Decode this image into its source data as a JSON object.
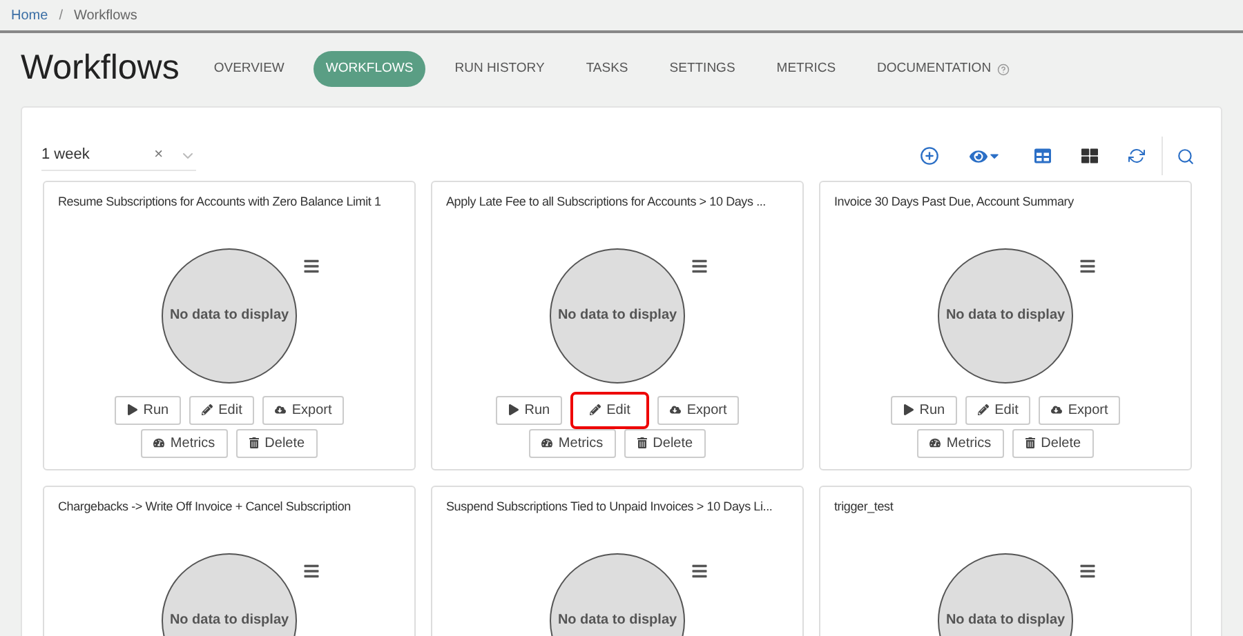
{
  "breadcrumb": [
    {
      "label": "Home",
      "link": true
    },
    {
      "label": "Workflows",
      "link": false
    }
  ],
  "breadcrumb_separator": "/",
  "page_title": "Workflows",
  "tabs": [
    {
      "label": "OVERVIEW",
      "selected": false
    },
    {
      "label": "WORKFLOWS",
      "selected": true
    },
    {
      "label": "RUN HISTORY",
      "selected": false
    },
    {
      "label": "TASKS",
      "selected": false
    },
    {
      "label": "SETTINGS",
      "selected": false
    },
    {
      "label": "METRICS",
      "selected": false
    },
    {
      "label": "DOCUMENTATION",
      "selected": false,
      "help": true
    }
  ],
  "filter": {
    "value": "1 week",
    "clear": "×"
  },
  "cards": [
    {
      "title": "Resume Subscriptions for Accounts with Zero Balance Limit 1",
      "chart_text": "No data to display",
      "buttons": [
        {
          "kind": "run",
          "label": "Run",
          "highlighted": false
        },
        {
          "kind": "edit",
          "label": "Edit",
          "highlighted": false
        },
        {
          "kind": "export",
          "label": "Export",
          "highlighted": false
        },
        {
          "kind": "metrics",
          "label": "Metrics",
          "highlighted": false
        },
        {
          "kind": "delete",
          "label": "Delete",
          "highlighted": false
        }
      ]
    },
    {
      "title": "Apply Late Fee to all Subscriptions for Accounts > 10 Days ...",
      "chart_text": "No data to display",
      "buttons": [
        {
          "kind": "run",
          "label": "Run",
          "highlighted": false
        },
        {
          "kind": "edit",
          "label": "Edit",
          "highlighted": true
        },
        {
          "kind": "export",
          "label": "Export",
          "highlighted": false
        },
        {
          "kind": "metrics",
          "label": "Metrics",
          "highlighted": false
        },
        {
          "kind": "delete",
          "label": "Delete",
          "highlighted": false
        }
      ]
    },
    {
      "title": "Invoice 30 Days Past Due, Account Summary",
      "chart_text": "No data to display",
      "buttons": [
        {
          "kind": "run",
          "label": "Run",
          "highlighted": false
        },
        {
          "kind": "edit",
          "label": "Edit",
          "highlighted": false
        },
        {
          "kind": "export",
          "label": "Export",
          "highlighted": false
        },
        {
          "kind": "metrics",
          "label": "Metrics",
          "highlighted": false
        },
        {
          "kind": "delete",
          "label": "Delete",
          "highlighted": false
        }
      ]
    },
    {
      "title": "Chargebacks -> Write Off Invoice + Cancel Subscription",
      "chart_text": "No data to display"
    },
    {
      "title": "Suspend Subscriptions Tied to Unpaid Invoices > 10 Days Li...",
      "chart_text": "No data to display"
    },
    {
      "title": "trigger_test",
      "chart_text": "No data to display"
    }
  ]
}
